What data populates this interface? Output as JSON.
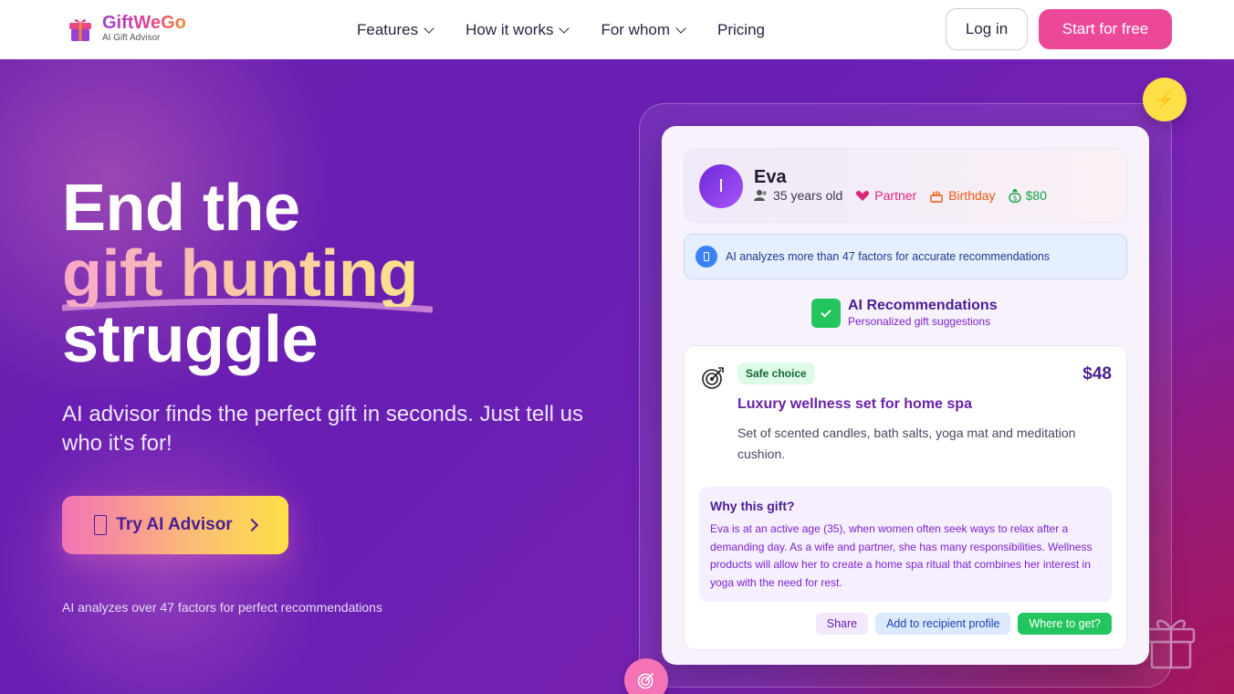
{
  "header": {
    "brand_name": "GiftWeGo",
    "brand_tagline": "AI Gift Advisor",
    "nav": [
      {
        "label": "Features",
        "has_dropdown": true
      },
      {
        "label": "How it works",
        "has_dropdown": true
      },
      {
        "label": "For whom",
        "has_dropdown": true
      },
      {
        "label": "Pricing",
        "has_dropdown": false
      }
    ],
    "login_label": "Log in",
    "start_label": "Start for free"
  },
  "hero": {
    "headline_1": "End the",
    "headline_2": "gift hunting",
    "headline_3": "struggle",
    "subtitle": "AI advisor finds the perfect gift in seconds. Just tell us who it's for!",
    "cta_label": "Try AI Advisor",
    "footnote": "AI analyzes over 47 factors for perfect recommendations"
  },
  "mockup": {
    "profile": {
      "avatar_initial": "I",
      "name": "Eva",
      "age": "35 years old",
      "relation": "Partner",
      "occasion": "Birthday",
      "budget": "$80"
    },
    "info_text": "AI analyzes more than 47 factors for accurate recommendations",
    "rec_title": "AI Recommendations",
    "rec_subtitle": "Personalized gift suggestions",
    "gift": {
      "badge": "Safe choice",
      "price": "$48",
      "title": "Luxury wellness set for home spa",
      "description": "Set of scented candles, bath salts, yoga mat and meditation cushion.",
      "why_title": "Why this gift?",
      "why_text": "Eva is at an active age (35), when women often seek ways to relax after a demanding day. As a wife and partner, she has many responsibilities. Wellness products will allow her to create a home spa ritual that combines her interest in yoga with the need for rest.",
      "actions": [
        "Share",
        "Add to recipient profile",
        "Where to get?"
      ]
    },
    "bolt_glyph": "⚡"
  },
  "colors": {
    "brand_pink": "#ec4899",
    "hero_purple": "#6a1fb0",
    "accent_green": "#22c55e",
    "accent_yellow": "#fde047"
  },
  "icons": [
    "gift-icon",
    "chevron-down-icon",
    "lightning-icon",
    "target-icon",
    "check-icon",
    "info-icon",
    "users-icon",
    "heart-icon",
    "cake-icon",
    "money-icon",
    "tablet-icon",
    "chevron-right-icon"
  ]
}
